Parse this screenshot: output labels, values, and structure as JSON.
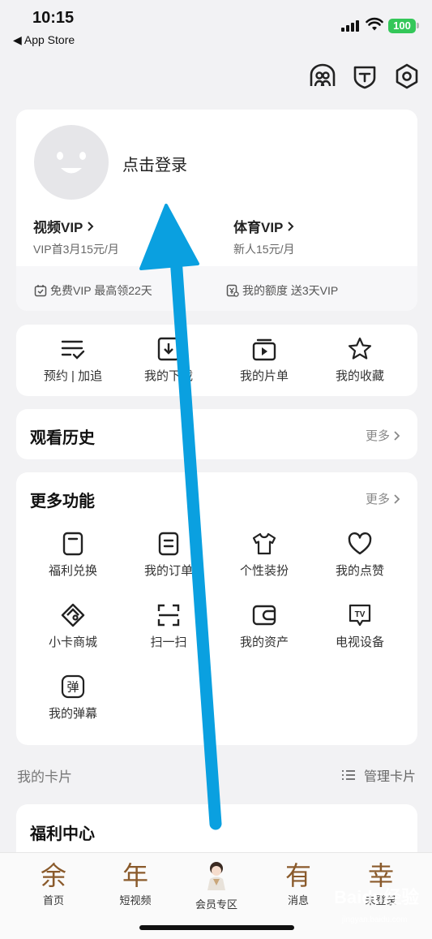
{
  "status_bar": {
    "time": "10:15",
    "back_app": "◀ App Store",
    "battery": "100"
  },
  "header_icons": [
    "friends-icon",
    "shield-icon",
    "settings-icon"
  ],
  "profile": {
    "login_label": "点击登录",
    "video_vip": {
      "title": "视频VIP",
      "subtitle": "VIP首3月15元/月"
    },
    "sports_vip": {
      "title": "体育VIP",
      "subtitle": "新人15元/月"
    },
    "benefit_left": "免费VIP 最高领22天",
    "benefit_right": "我的额度 送3天VIP"
  },
  "quick_actions": [
    {
      "label": "预约 | 加追",
      "icon": "list-check-icon"
    },
    {
      "label": "我的下载",
      "icon": "download-icon"
    },
    {
      "label": "我的片单",
      "icon": "playlist-icon"
    },
    {
      "label": "我的收藏",
      "icon": "star-icon"
    }
  ],
  "history": {
    "title": "观看历史",
    "more": "更多"
  },
  "more_features": {
    "title": "更多功能",
    "more": "更多",
    "items": [
      {
        "label": "福利兑换",
        "icon": "gift-card-icon"
      },
      {
        "label": "我的订单",
        "icon": "order-icon"
      },
      {
        "label": "个性装扮",
        "icon": "tshirt-icon"
      },
      {
        "label": "我的点赞",
        "icon": "heart-icon"
      },
      {
        "label": "小卡商城",
        "icon": "card-shop-icon"
      },
      {
        "label": "扫一扫",
        "icon": "scan-icon"
      },
      {
        "label": "我的资产",
        "icon": "wallet-icon"
      },
      {
        "label": "电视设备",
        "icon": "tv-icon"
      },
      {
        "label": "我的弹幕",
        "icon": "danmaku-icon"
      }
    ],
    "danmaku_glyph": "弹",
    "tv_glyph": "TV"
  },
  "my_cards": {
    "title": "我的卡片",
    "manage": "管理卡片"
  },
  "welfare": {
    "title": "福利中心"
  },
  "tabs": [
    {
      "glyph": "余",
      "label": "首页"
    },
    {
      "glyph": "年",
      "label": "短视频"
    },
    {
      "glyph": "",
      "label": "会员专区"
    },
    {
      "glyph": "有",
      "label": "消息"
    },
    {
      "glyph": "幸",
      "label": "未登录"
    }
  ],
  "watermark": {
    "text": "Baidu经验",
    "sub": "jingyan.baidu.com"
  },
  "colors": {
    "arrow": "#0aa0e0",
    "tab_glyph": "#8a5a2b",
    "battery": "#34c759"
  }
}
